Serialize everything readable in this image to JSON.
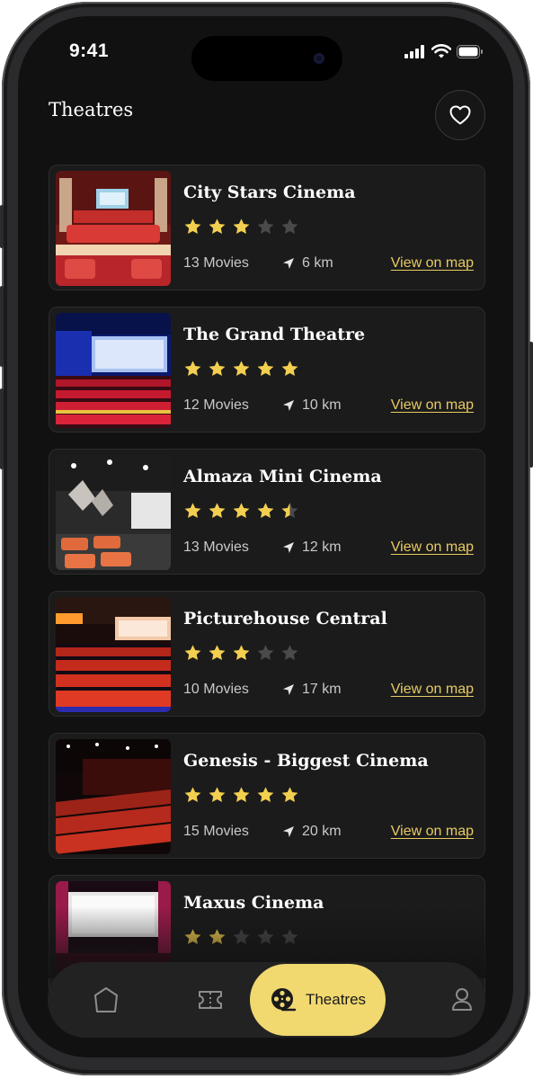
{
  "status_bar": {
    "time": "9:41"
  },
  "header": {
    "title": "Theatres",
    "favorite_icon": "heart-icon"
  },
  "colors": {
    "accent": "#f1d86f",
    "star_filled": "#f2cf4f",
    "star_empty": "#4a4a4a",
    "link": "#e8cb62",
    "background": "#111111",
    "card": "#1b1b1b"
  },
  "theatres": [
    {
      "name": "City Stars Cinema",
      "rating": 3,
      "movies": "13 Movies",
      "distance": "6 km",
      "map_link": "View on map"
    },
    {
      "name": "The Grand Theatre",
      "rating": 5,
      "movies": "12 Movies",
      "distance": "10 km",
      "map_link": "View on map"
    },
    {
      "name": "Almaza Mini Cinema",
      "rating": 4.5,
      "movies": "13 Movies",
      "distance": "12 km",
      "map_link": "View on map"
    },
    {
      "name": "Picturehouse Central",
      "rating": 3,
      "movies": "10 Movies",
      "distance": "17 km",
      "map_link": "View on map"
    },
    {
      "name": "Genesis - Biggest Cinema",
      "rating": 5,
      "movies": "15 Movies",
      "distance": "20 km",
      "map_link": "View on map"
    },
    {
      "name": "Maxus Cinema",
      "rating": 2
    }
  ],
  "tabbar": {
    "items": [
      {
        "icon": "home-icon"
      },
      {
        "icon": "ticket-icon"
      },
      {
        "icon": "film-reel-icon",
        "label": "Theatres",
        "active": true
      },
      {
        "icon": "profile-icon"
      }
    ]
  }
}
